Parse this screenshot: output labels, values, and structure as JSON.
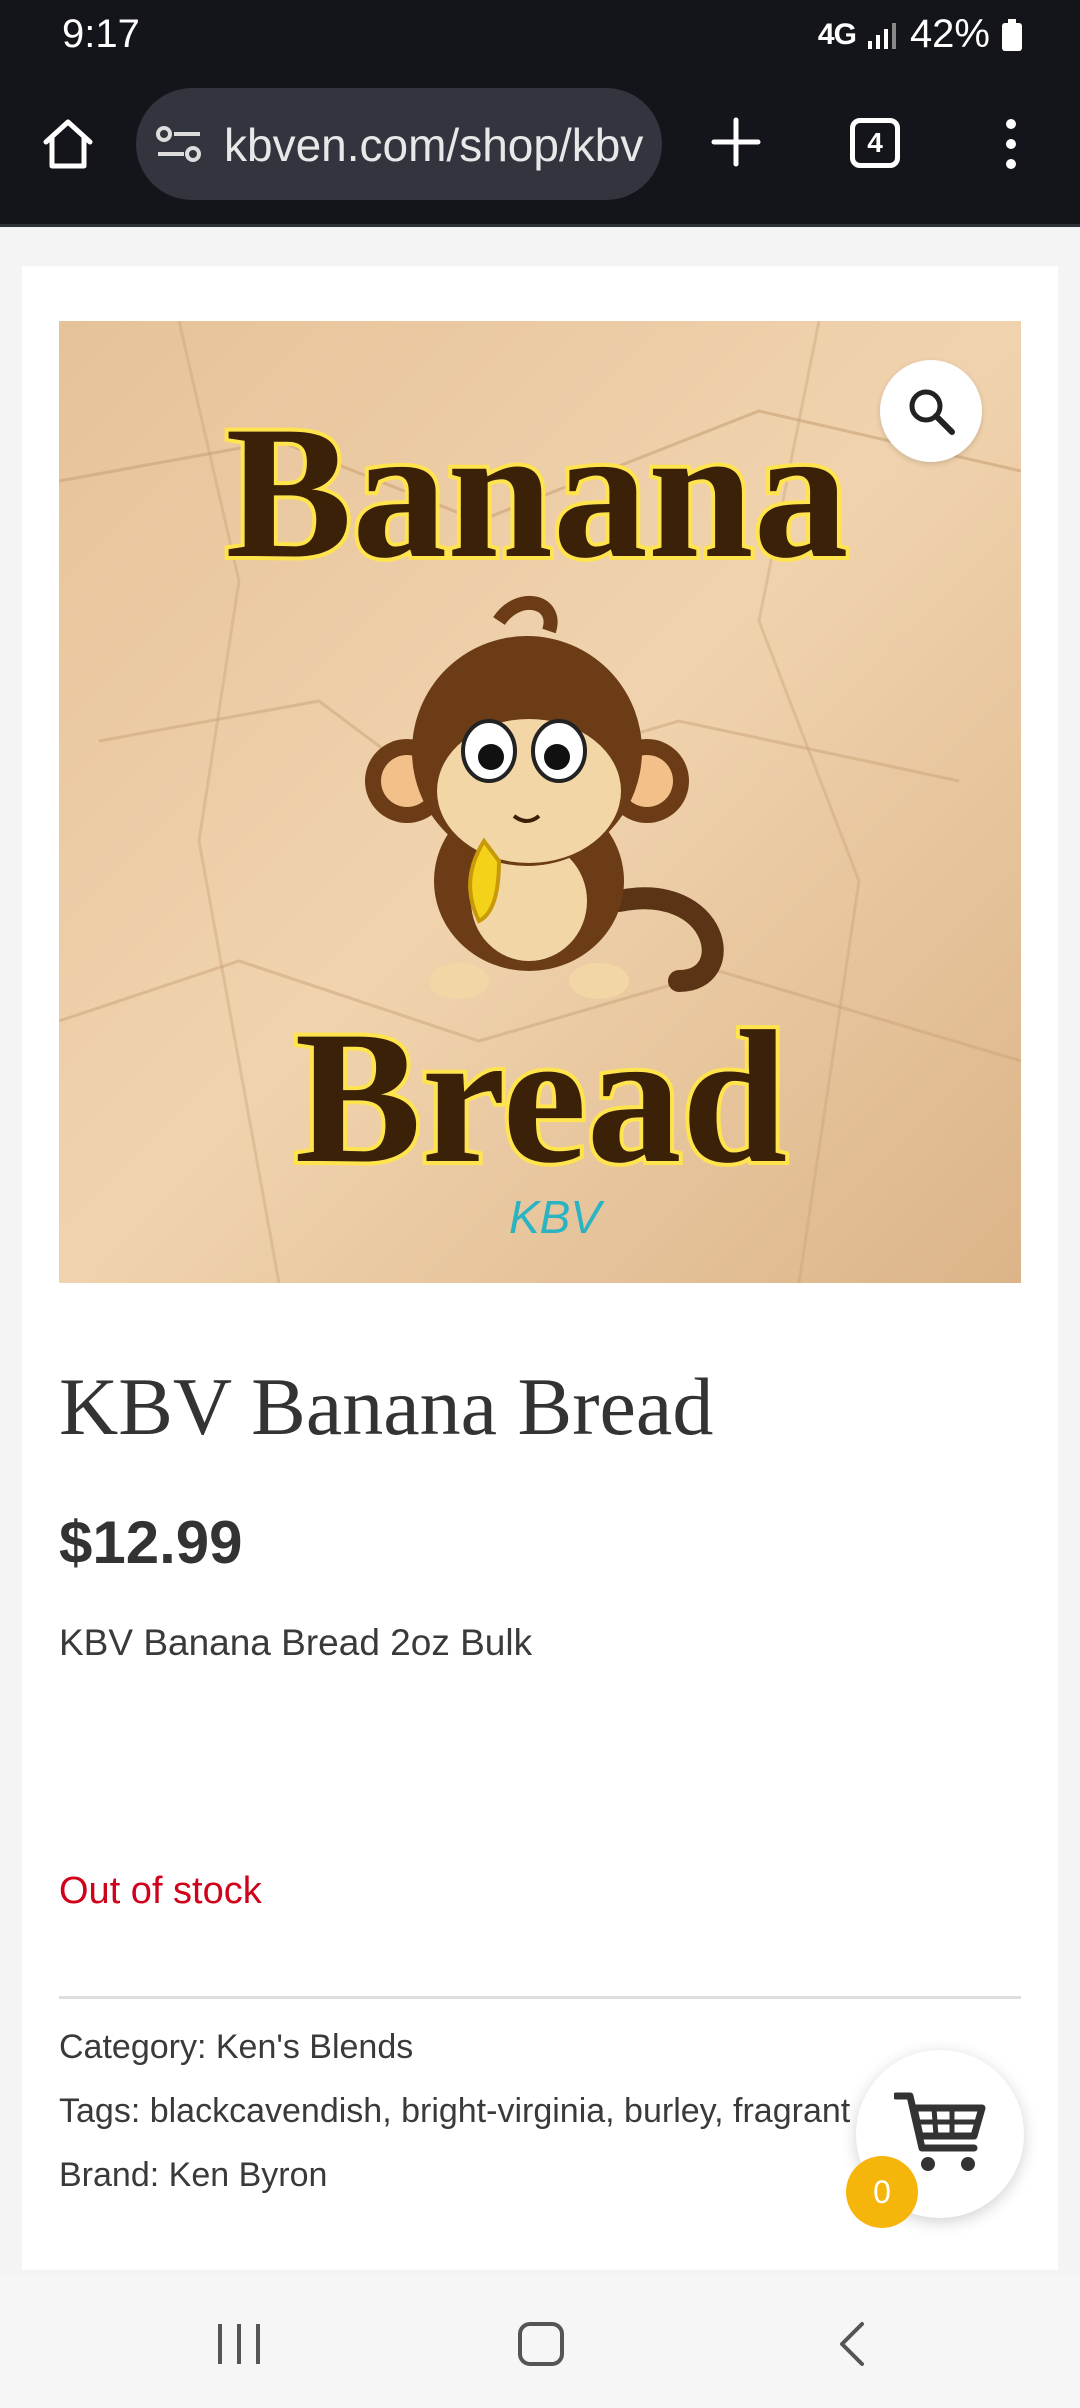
{
  "status_bar": {
    "time": "9:17",
    "network": "4G",
    "battery": "42%"
  },
  "browser": {
    "url": "kbven.com/shop/kbv",
    "tab_count": "4"
  },
  "product": {
    "image_alt": "KBV Banana Bread logo",
    "image_text_top": "Banana",
    "image_text_bottom": "Bread",
    "image_brand_mark": "KBV",
    "title": "KBV Banana Bread",
    "price": "$12.99",
    "short_description": "KBV Banana Bread 2oz Bulk",
    "stock_status": "Out of stock"
  },
  "meta": {
    "category_label": "Category:",
    "category_value": "Ken's Blends",
    "tags_label": "Tags:",
    "tags_value": "blackcavendish, bright-virginia, burley, fragrant",
    "brand_label": "Brand:",
    "brand_value": "Ken Byron"
  },
  "cart": {
    "count": "0"
  },
  "icons": {
    "home": "home-icon",
    "site_settings": "tune-icon",
    "new_tab": "plus-icon",
    "tabs": "tab-switcher-icon",
    "menu": "more-vert-icon",
    "zoom": "search-icon",
    "cart": "cart-icon",
    "recents": "recents-icon",
    "nav_home": "nav-home-icon",
    "back": "back-icon"
  },
  "colors": {
    "browser_bg": "#14151b",
    "out_of_stock": "#d0021b",
    "cart_badge": "#f5b50a",
    "title_text": "#333333"
  }
}
